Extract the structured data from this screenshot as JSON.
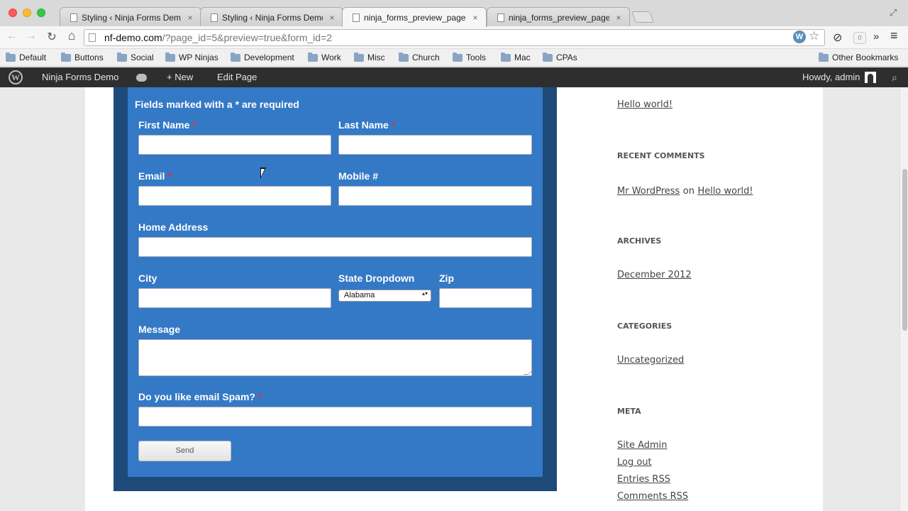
{
  "browser": {
    "tabs": [
      {
        "title": "Styling ‹ Ninja Forms Demo — WordPress"
      },
      {
        "title": "Styling ‹ Ninja Forms Demo — WordPress"
      },
      {
        "title": "ninja_forms_preview_page | Ninja Forms Demo"
      },
      {
        "title": "ninja_forms_preview_page | Ninja Forms Demo"
      }
    ],
    "close_glyph": "×",
    "url_host": "nf-demo.com",
    "url_path": "/?page_id=5&preview=true&form_id=2",
    "wp_ext_label": "W",
    "ext_badge": "0",
    "bookmarks": [
      "Default",
      "Buttons",
      "Social",
      "WP Ninjas",
      "Development",
      "Work",
      "Misc",
      "Church",
      "Tools",
      "Mac",
      "CPAs"
    ],
    "other_bookmarks": "Other Bookmarks",
    "glyphs": {
      "back": "←",
      "forward": "→",
      "reload": "↻",
      "home": "⌂",
      "star": "☆",
      "more": "»",
      "menu": "≡",
      "fullscreen": "⤢",
      "ext": "⊘"
    }
  },
  "adminbar": {
    "site_name": "Ninja Forms Demo",
    "new_label": "+ New",
    "edit_label": "Edit Page",
    "greeting": "Howdy, admin",
    "wp_glyph": "W",
    "search_glyph": "⌕"
  },
  "form": {
    "required_note": "Fields marked with a * are required",
    "required_star": "*",
    "first_name": "First Name",
    "last_name": "Last Name",
    "email": "Email",
    "mobile": "Mobile #",
    "address": "Home Address",
    "city": "City",
    "state": "State Dropdown",
    "state_value": "Alabama",
    "state_arrows": "▴▾",
    "zip": "Zip",
    "message": "Message",
    "spam": "Do you like email Spam?",
    "send": "Send"
  },
  "sidebar": {
    "recent_post": "Hello world!",
    "recent_comments_heading": "RECENT COMMENTS",
    "comment_author": "Mr WordPress",
    "comment_on": "on",
    "comment_post": "Hello world!",
    "archives_heading": "ARCHIVES",
    "archive_item": "December 2012",
    "categories_heading": "CATEGORIES",
    "category_item": "Uncategorized",
    "meta_heading": "META",
    "meta_items": [
      "Site Admin",
      "Log out",
      "Entries RSS",
      "Comments RSS"
    ]
  }
}
